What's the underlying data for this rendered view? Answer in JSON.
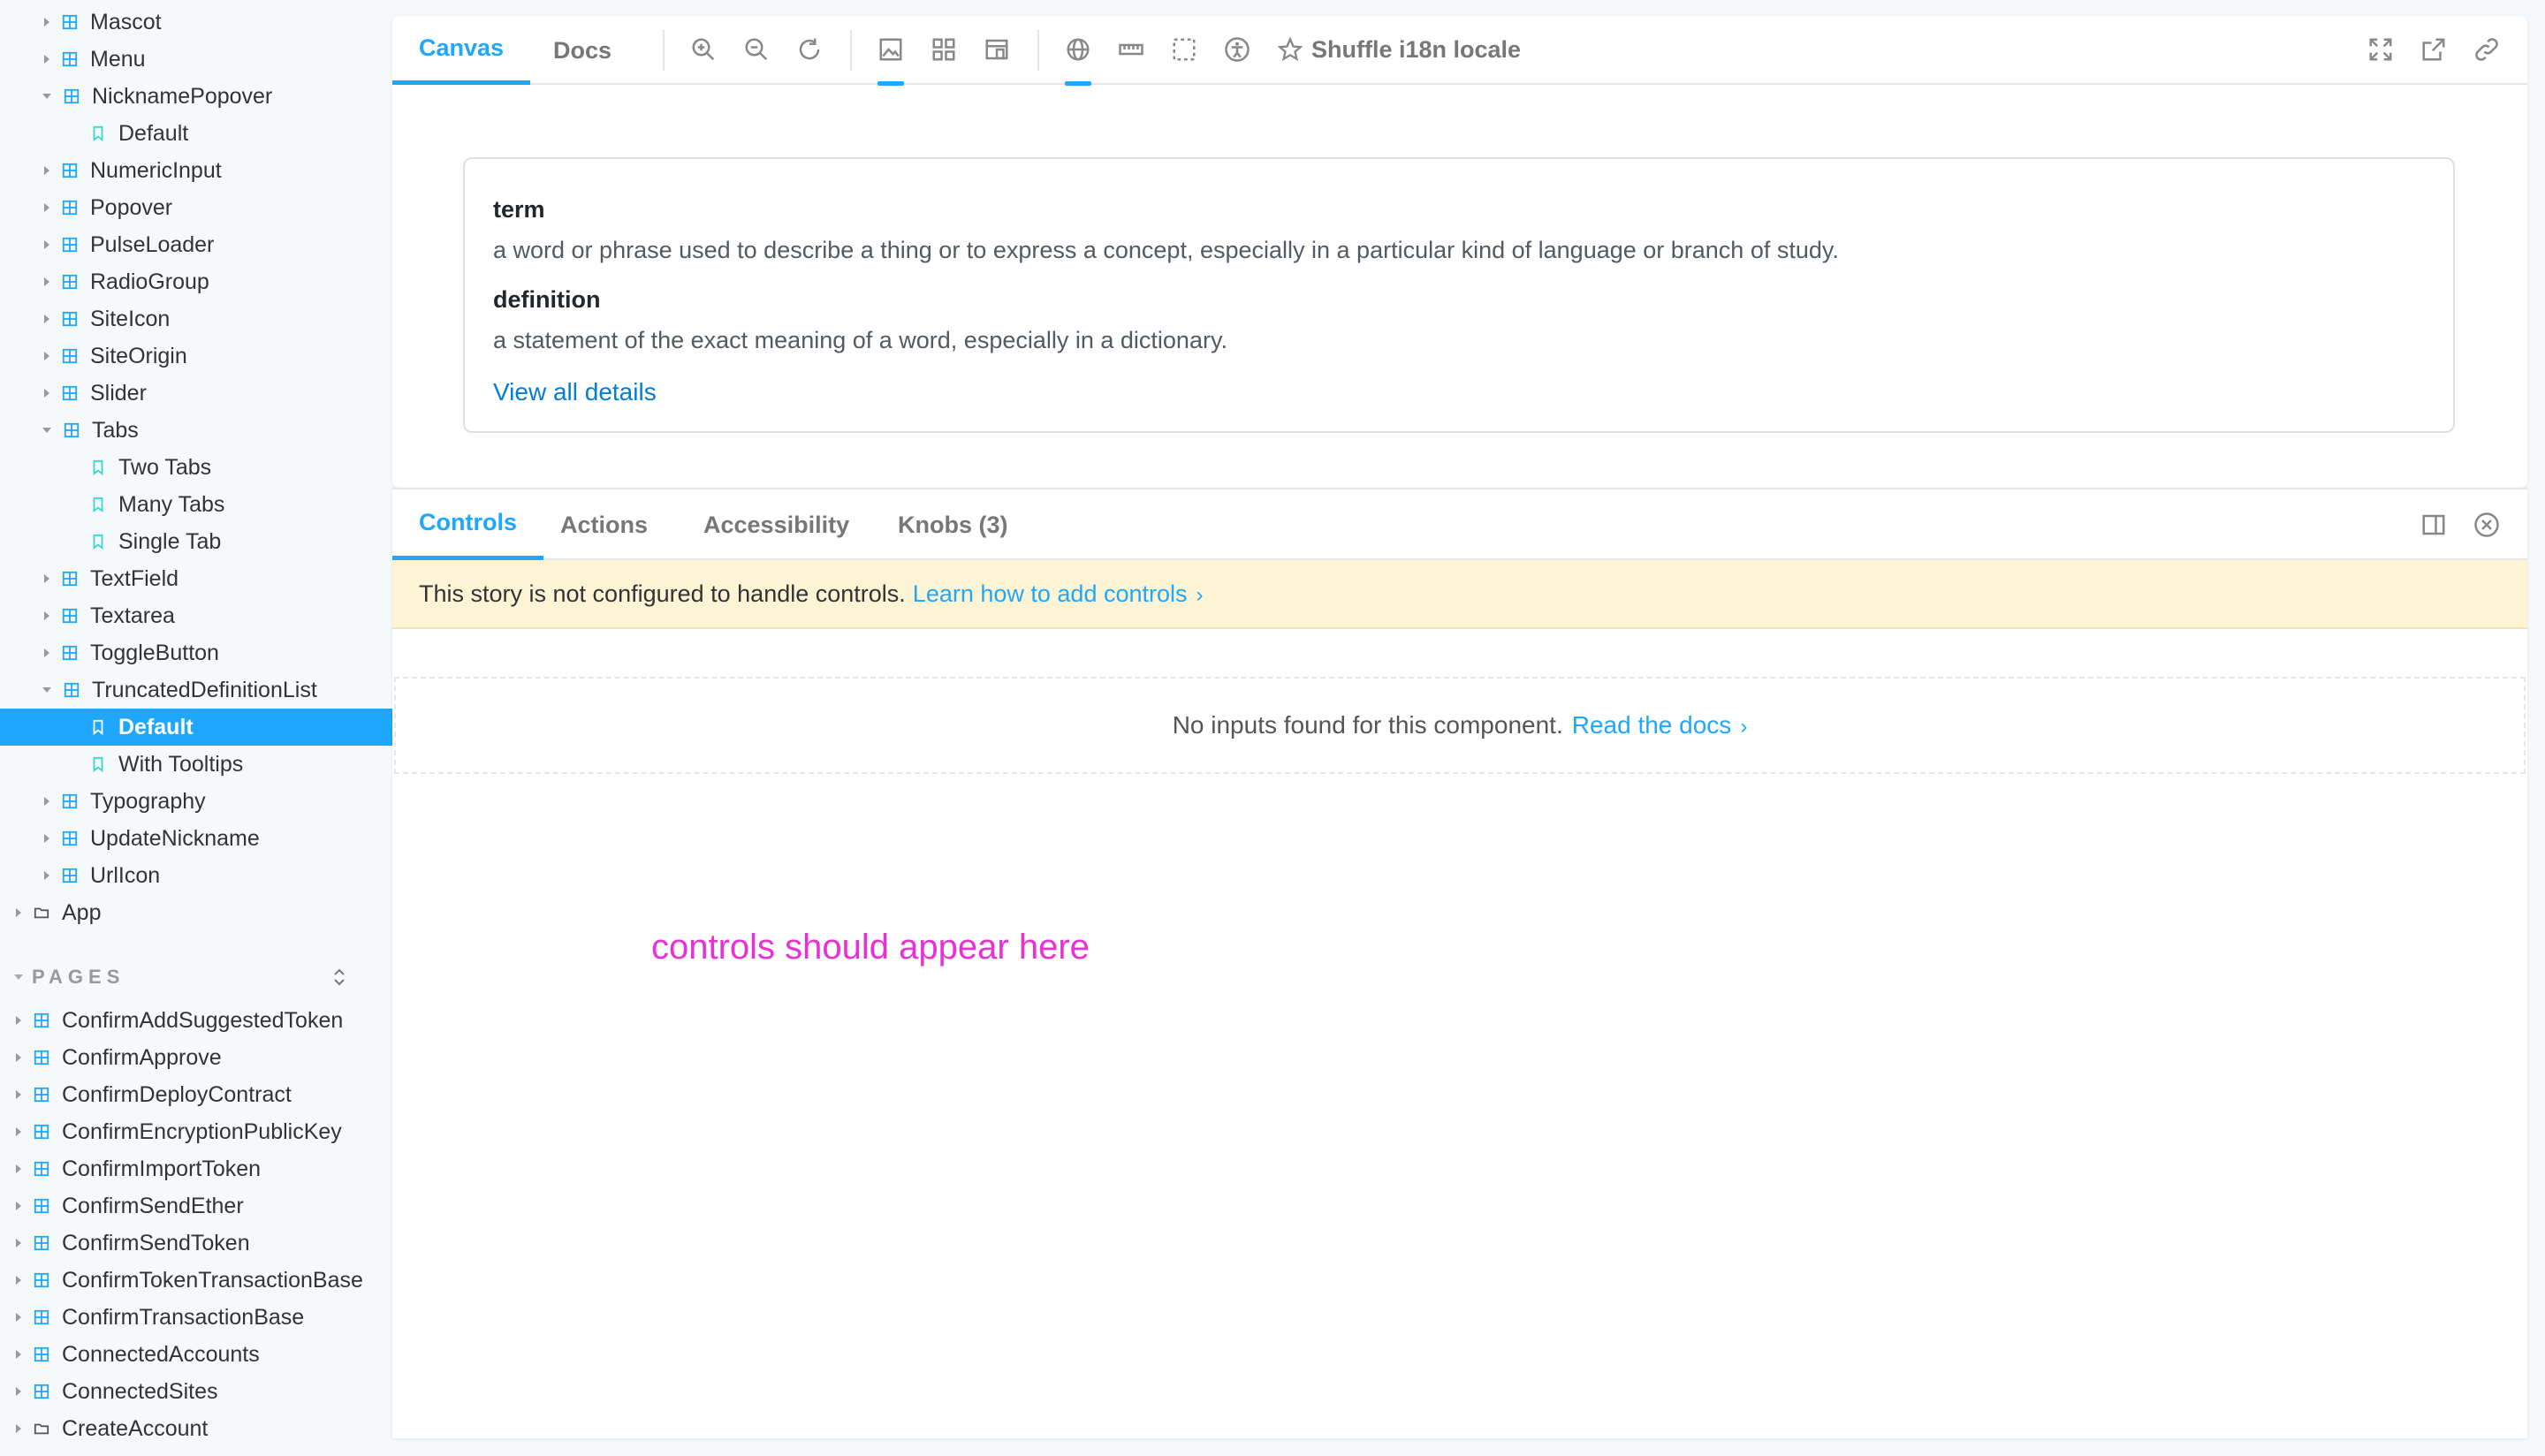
{
  "sidebar": {
    "items": [
      {
        "label": "Mascot",
        "type": "component",
        "state": "collapsed"
      },
      {
        "label": "Menu",
        "type": "component",
        "state": "collapsed"
      },
      {
        "label": "NicknamePopover",
        "type": "component",
        "state": "expanded"
      },
      {
        "label": "Default",
        "type": "story"
      },
      {
        "label": "NumericInput",
        "type": "component",
        "state": "collapsed"
      },
      {
        "label": "Popover",
        "type": "component",
        "state": "collapsed"
      },
      {
        "label": "PulseLoader",
        "type": "component",
        "state": "collapsed"
      },
      {
        "label": "RadioGroup",
        "type": "component",
        "state": "collapsed"
      },
      {
        "label": "SiteIcon",
        "type": "component",
        "state": "collapsed"
      },
      {
        "label": "SiteOrigin",
        "type": "component",
        "state": "collapsed"
      },
      {
        "label": "Slider",
        "type": "component",
        "state": "collapsed"
      },
      {
        "label": "Tabs",
        "type": "component",
        "state": "expanded"
      },
      {
        "label": "Two Tabs",
        "type": "story"
      },
      {
        "label": "Many Tabs",
        "type": "story"
      },
      {
        "label": "Single Tab",
        "type": "story"
      },
      {
        "label": "TextField",
        "type": "component",
        "state": "collapsed"
      },
      {
        "label": "Textarea",
        "type": "component",
        "state": "collapsed"
      },
      {
        "label": "ToggleButton",
        "type": "component",
        "state": "collapsed"
      },
      {
        "label": "TruncatedDefinitionList",
        "type": "component",
        "state": "expanded"
      },
      {
        "label": "Default",
        "type": "story",
        "selected": true
      },
      {
        "label": "With Tooltips",
        "type": "story"
      },
      {
        "label": "Typography",
        "type": "component",
        "state": "collapsed"
      },
      {
        "label": "UpdateNickname",
        "type": "component",
        "state": "collapsed"
      },
      {
        "label": "UrlIcon",
        "type": "component",
        "state": "collapsed"
      },
      {
        "label": "App",
        "type": "folder",
        "state": "collapsed"
      }
    ],
    "pages_header": "PAGES",
    "pages": [
      {
        "label": "ConfirmAddSuggestedToken",
        "type": "component"
      },
      {
        "label": "ConfirmApprove",
        "type": "component"
      },
      {
        "label": "ConfirmDeployContract",
        "type": "component"
      },
      {
        "label": "ConfirmEncryptionPublicKey",
        "type": "component"
      },
      {
        "label": "ConfirmImportToken",
        "type": "component"
      },
      {
        "label": "ConfirmSendEther",
        "type": "component"
      },
      {
        "label": "ConfirmSendToken",
        "type": "component"
      },
      {
        "label": "ConfirmTokenTransactionBase",
        "type": "component"
      },
      {
        "label": "ConfirmTransactionBase",
        "type": "component"
      },
      {
        "label": "ConnectedAccounts",
        "type": "component"
      },
      {
        "label": "ConnectedSites",
        "type": "component"
      },
      {
        "label": "CreateAccount",
        "type": "folder"
      }
    ]
  },
  "toolbar": {
    "tabs": [
      "Canvas",
      "Docs"
    ],
    "shuffle_label": "Shuffle i18n locale",
    "icons": [
      "zoom-in-icon",
      "zoom-out-icon",
      "zoom-reset-icon",
      "background-icon",
      "grid-icon",
      "viewport-icon",
      "locale-globe-icon",
      "measure-icon",
      "outline-icon",
      "accessibility-icon",
      "star-icon",
      "fullscreen-icon",
      "open-new-tab-icon",
      "copy-link-icon"
    ]
  },
  "preview": {
    "items": [
      {
        "term": "term",
        "definition": "a word or phrase used to describe a thing or to express a concept, especially in a particular kind of language or branch of study."
      },
      {
        "term": "definition",
        "definition": "a statement of the exact meaning of a word, especially in a dictionary."
      }
    ],
    "view_all": "View all details"
  },
  "addons": {
    "tabs": [
      "Controls",
      "Actions",
      "Accessibility",
      "Knobs (3)"
    ],
    "notice_text": "This story is not configured to handle controls.",
    "notice_link": "Learn how to add controls",
    "empty_text": "No inputs found for this component.",
    "empty_link": "Read the docs",
    "controls_note": "controls should appear here"
  },
  "colors": {
    "accent": "#1ea7fd",
    "notice_bg": "#fcf4d5",
    "note_magenta": "#e930d6",
    "link_blue": "#037dd6"
  }
}
